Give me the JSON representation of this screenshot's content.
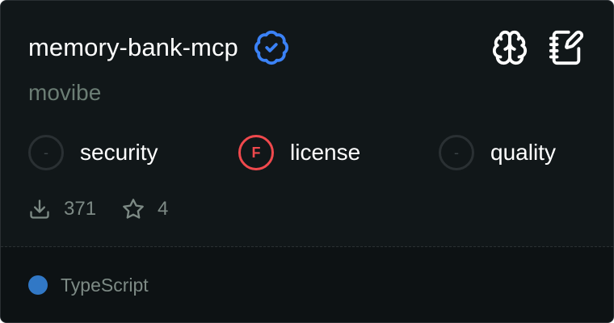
{
  "card": {
    "title": "memory-bank-mcp",
    "author": "movibe",
    "verified_icon": "verified-badge-icon",
    "accent_color": "#3b82f6",
    "top_icons": [
      "brain-icon",
      "notebook-edit-icon"
    ]
  },
  "scores": [
    {
      "label": "security",
      "grade": "-",
      "status": "neutral"
    },
    {
      "label": "license",
      "grade": "F",
      "status": "fail",
      "color": "#f0494d"
    },
    {
      "label": "quality",
      "grade": "-",
      "status": "neutral"
    }
  ],
  "stats": {
    "downloads": "371",
    "downloads_icon": "download-icon",
    "stars": "4",
    "stars_icon": "star-icon"
  },
  "footer": {
    "language": "TypeScript",
    "language_color": "#3178c6"
  }
}
